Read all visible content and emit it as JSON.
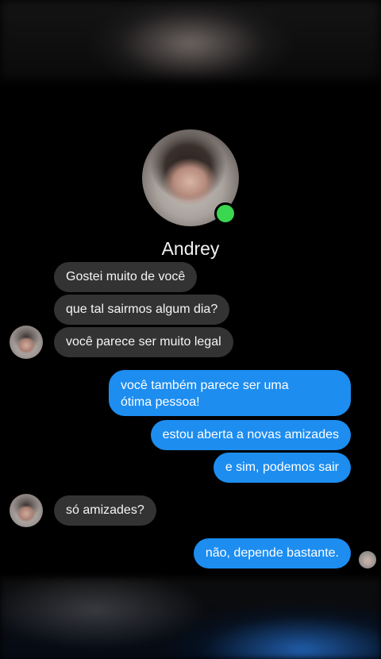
{
  "contact": {
    "name": "Andrey",
    "status": "online"
  },
  "messages": [
    {
      "side": "in",
      "text": "Gostei muito de você"
    },
    {
      "side": "in",
      "text": "que tal sairmos algum dia?"
    },
    {
      "side": "in",
      "text": "você parece ser muito legal"
    },
    {
      "side": "out",
      "line1": "você também parece ser uma",
      "line2": "ótima pessoa!"
    },
    {
      "side": "out",
      "text": "estou aberta a novas amizades"
    },
    {
      "side": "out",
      "text": "e sim, podemos sair"
    },
    {
      "side": "in",
      "text": "só amizades?"
    },
    {
      "side": "out",
      "text": "não, depende bastante."
    }
  ],
  "colors": {
    "incoming_bubble": "#333333",
    "outgoing_bubble": "#1d8df0",
    "online_dot": "#3ad64f",
    "background": "#000000"
  }
}
